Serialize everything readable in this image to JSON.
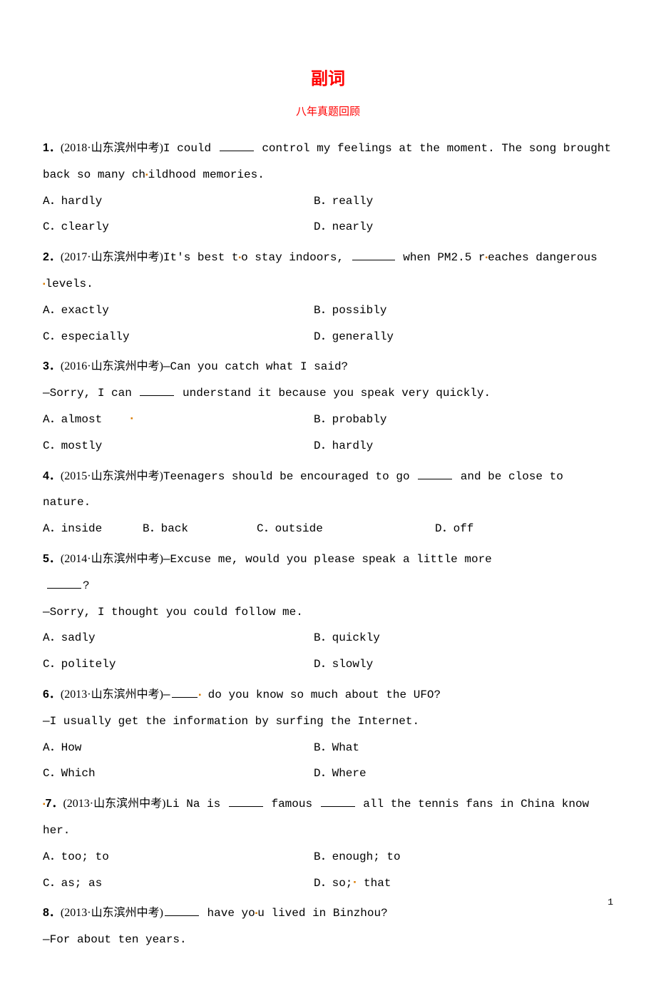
{
  "title": "副词",
  "subtitle": "八年真题回顾",
  "page_number": "1",
  "questions": [
    {
      "num": "1．",
      "src": "(2018·山东滨州中考)",
      "text_pre": "I could ",
      "text_post": " control my feelings at the moment. The song brought back so many ch",
      "text_post2": "ildhood memories.",
      "options": [
        {
          "label": "A．hardly",
          "label2": "B．really"
        },
        {
          "label": "C．clearly",
          "label2": "D．nearly"
        }
      ]
    },
    {
      "num": "2．",
      "src": "(2017·山东滨州中考)",
      "text_pre": "It's best t",
      "text_mid": "o stay indoors, ",
      "text_post": " when PM2.5 r",
      "text_post2": "eaches dangerous ",
      "text_line2": "levels.",
      "options": [
        {
          "label": "A．exactly",
          "label2": "B．possibly"
        },
        {
          "label": "C．especially",
          "label2": "D．generally"
        }
      ]
    },
    {
      "num": "3．",
      "src": "(2016·山东滨州中考)",
      "text": "—Can you catch what I said?",
      "line2_pre": "—Sorry, I can ",
      "line2_post": " understand it because you speak very quickly.",
      "options": [
        {
          "label": "A．almost",
          "label2": "B．probably"
        },
        {
          "label": "C．mostly",
          "label2": "D．hardly"
        }
      ]
    },
    {
      "num": "4．",
      "src": "(2015·山东滨州中考)",
      "text_pre": "Teenagers should be encouraged to go ",
      "text_post": " and be close to nature.",
      "options4": {
        "a": "A．inside",
        "b": "B．back",
        "c": "C．outside",
        "d": "D．off"
      }
    },
    {
      "num": "5．",
      "src": "(2014·山东滨州中考)",
      "text": "—Excuse me, would you please speak a little more",
      "line2": "?",
      "line3": "—Sorry, I thought you could follow me.",
      "options": [
        {
          "label": "A．sadly",
          "label2": "B．quickly"
        },
        {
          "label": "C．politely",
          "label2": "D．slowly"
        }
      ]
    },
    {
      "num": "6．",
      "src": "(2013·山东滨州中考)",
      "text_pre": "—",
      "text_post": " do you know so much about the UFO?",
      "line2": "—I usually get the information by surfing the Internet.",
      "options": [
        {
          "label": "A．How",
          "label2": "B．What"
        },
        {
          "label": "C．Which",
          "label2": "D．Where"
        }
      ]
    },
    {
      "num": "7．",
      "src": "(2013·山东滨州中考)",
      "text_pre": "Li Na is ",
      "text_mid": " famous ",
      "text_post": " all the tennis fans in China know her.",
      "options": [
        {
          "label": "A．too; to",
          "label2": "B．enough; to"
        },
        {
          "label": "C．as; as",
          "label2": "D．so;",
          "label2_post": " that"
        }
      ]
    },
    {
      "num": "8．",
      "src": "(2013·山东滨州中考)",
      "text_pre": "",
      "text_mid": " have yo",
      "text_post": "u lived in Binzhou?",
      "line2": "—For about ten years."
    }
  ]
}
